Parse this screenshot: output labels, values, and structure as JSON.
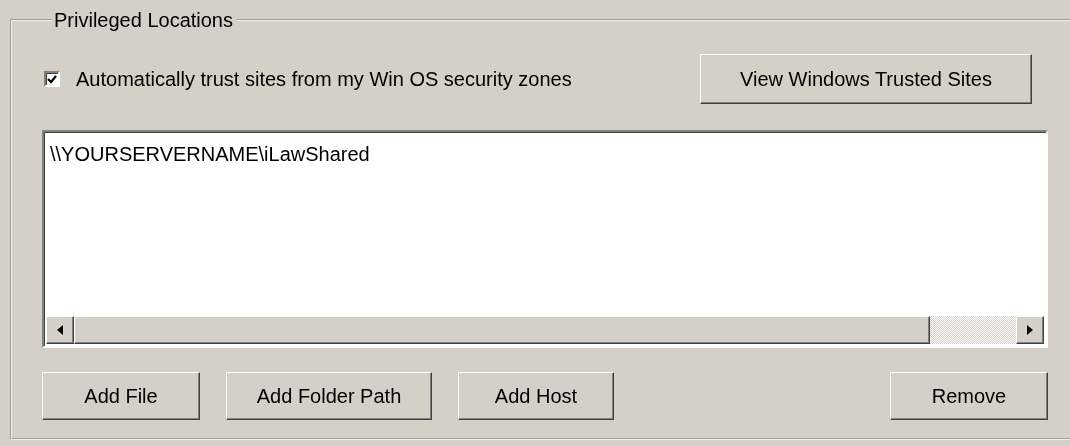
{
  "group": {
    "title": "Privileged Locations"
  },
  "trust_checkbox": {
    "label": "Automatically trust sites from my Win OS security zones",
    "checked": true
  },
  "view_button": {
    "label": "View Windows Trusted Sites"
  },
  "locations": {
    "items": [
      "\\\\YOURSERVERNAME\\iLawShared"
    ]
  },
  "left_buttons": [
    {
      "label": "Add File"
    },
    {
      "label": "Add Folder Path"
    },
    {
      "label": "Add Host"
    }
  ],
  "right_buttons": [
    {
      "label": "Remove"
    }
  ]
}
